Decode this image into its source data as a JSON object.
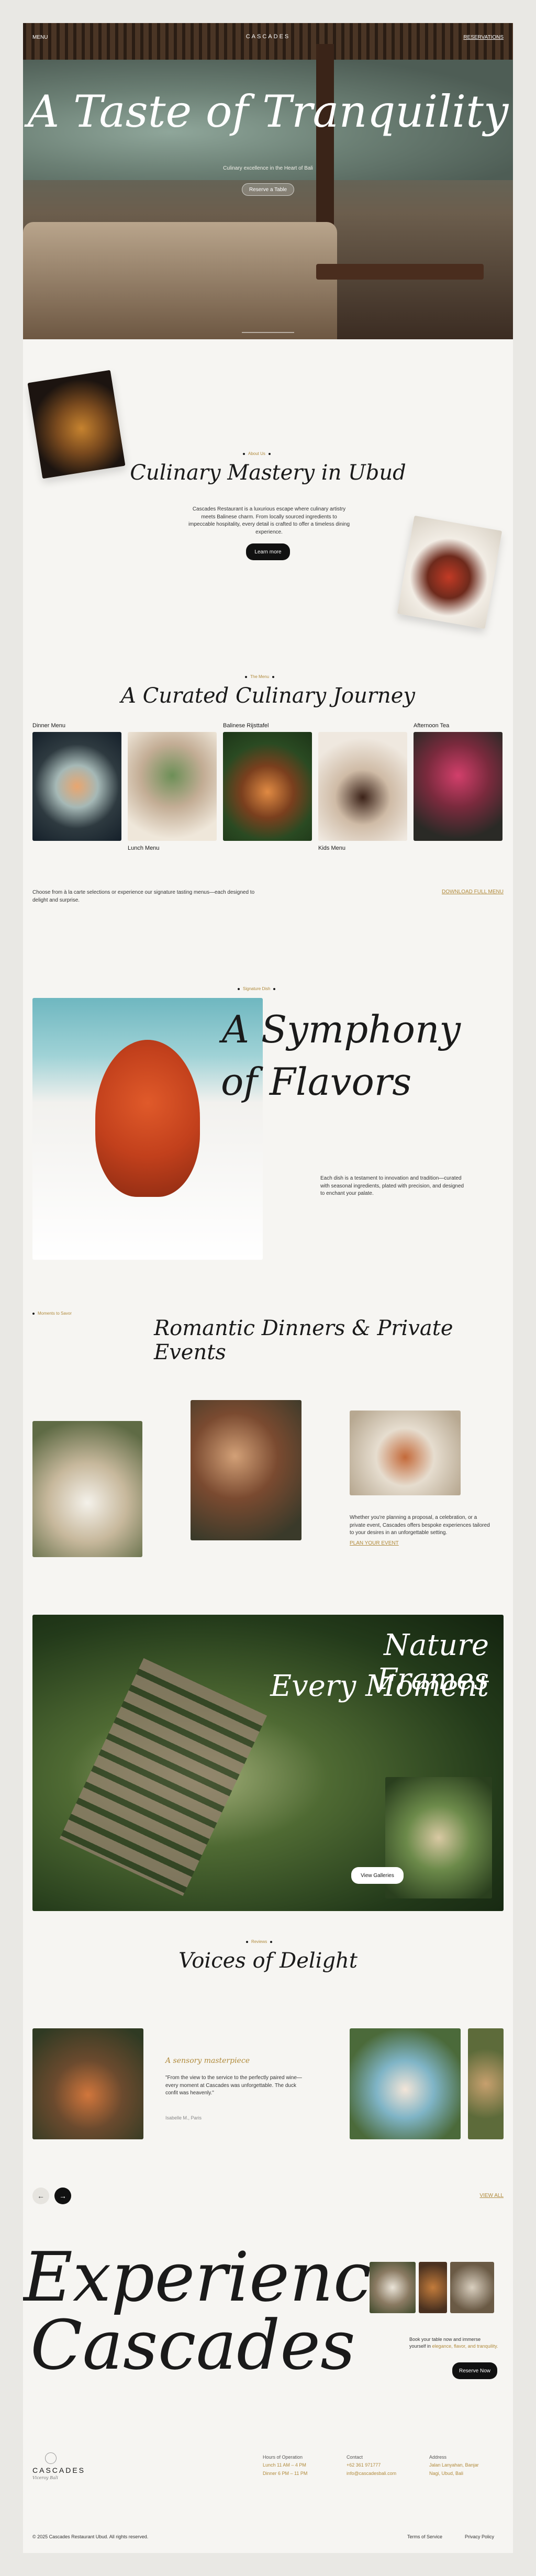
{
  "hero": {
    "menu_label": "MENU",
    "brand": "CASCADES",
    "reservations_label": "RESERVATIONS",
    "title": "A Taste of Tranquility",
    "subtitle": "Culinary excellence in the Heart of Bali",
    "cta": "Reserve a Table"
  },
  "mastery": {
    "eyebrow": "About Us",
    "title": "Culinary Mastery in Ubud",
    "body": "Cascades Restaurant is a luxurious escape where culinary artistry meets Balinese charm. From locally sourced ingredients to impeccable hospitality, every detail is crafted to offer a timeless dining experience.",
    "cta": "Learn more"
  },
  "journey": {
    "eyebrow": "The Menu",
    "title": "A Curated Culinary Journey",
    "menus": [
      {
        "label": "Dinner Menu"
      },
      {
        "label": "Lunch Menu"
      },
      {
        "label": "Balinese Rijsttafel"
      },
      {
        "label": "Kids Menu"
      },
      {
        "label": "Afternoon Tea"
      }
    ],
    "body": "Choose from à la carte selections or experience our signature tasting menus—each designed to delight and surprise.",
    "download": "DOWNLOAD FULL MENU"
  },
  "symphony": {
    "eyebrow": "Signature Dish",
    "title_line1": "A Symphony",
    "title_line2": "of Flavors",
    "body": "Each dish is a testament to innovation and tradition—curated with seasonal ingredients, plated with precision, and designed to enchant your palate."
  },
  "romantic": {
    "eyebrow": "Moments to Savor",
    "title": "Romantic Dinners & Private Events",
    "body": "Whether you're planning a proposal, a celebration, or a private event, Cascades offers bespoke experiences tailored to your desires in an unforgettable setting.",
    "cta": "PLAN YOUR EVENT"
  },
  "nature": {
    "title_line1": "Nature Frames",
    "title_line2": "Every Moment",
    "cta": "View Galleries"
  },
  "voices": {
    "eyebrow": "Reviews",
    "title": "Voices of Delight",
    "quote_title": "A sensory masterpiece",
    "quote": "\"From the view to the service to the perfectly paired wine—every moment at Cascades was unforgettable. The duck confit was heavenly.\"",
    "author": "Isabelle M., Paris",
    "view_all": "VIEW ALL",
    "prev_icon": "arrow-left-icon",
    "next_icon": "arrow-right-icon"
  },
  "experience": {
    "line1": "Experience",
    "line2": "Cascades",
    "body_prefix": "Book your table now and immerse yourself in",
    "body_highlight": "elegance, flavor, and tranquility.",
    "cta": "Reserve Now"
  },
  "footer": {
    "logo": "CASCADES",
    "logo_tag": "Viceroy Bali",
    "hours_title": "Hours of Operation",
    "hours_lunch": "Lunch 11 AM – 4 PM",
    "hours_dinner": "Dinner 6 PM – 11 PM",
    "contact_title": "Contact",
    "phone": "+62 361 971777",
    "email": "info@cascadesbali.com",
    "address_title": "Address",
    "address_1": "Jalan Lanyahan, Banjar",
    "address_2": "Nagi, Ubud, Bali",
    "copyright": "© 2025 Cascades Restaurant Ubud. All rights reserved.",
    "terms": "Terms of Service",
    "privacy": "Privacy Policy"
  },
  "colors": {
    "accent": "#b08a3b",
    "dark": "#111111",
    "background": "#f6f5f2"
  }
}
